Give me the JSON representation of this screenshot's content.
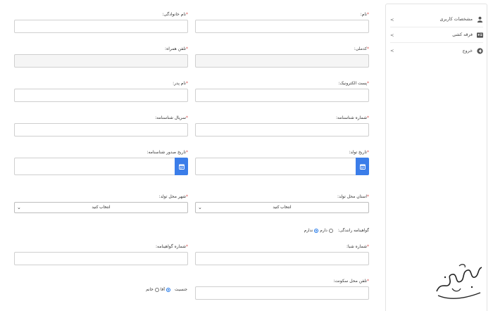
{
  "sidebar": {
    "items": [
      {
        "label": "مشخصات کاربری",
        "icon": "user-icon"
      },
      {
        "label": "فرقه کشی",
        "icon": "id-card-icon"
      },
      {
        "label": "خروج",
        "icon": "logout-icon"
      }
    ],
    "chevron": ">"
  },
  "form": {
    "required_mark": "*",
    "first_name": {
      "label": "نام:"
    },
    "last_name": {
      "label": "نام خانوادگی:"
    },
    "national_code": {
      "label": "کدملی:"
    },
    "mobile": {
      "label": "تلفن همراه:"
    },
    "email": {
      "label": "پست الکترونیک:"
    },
    "father_name": {
      "label": "نام پدر:"
    },
    "id_number": {
      "label": "شماره شناسنامه:"
    },
    "id_serial": {
      "label": "سریال شناسنامه:"
    },
    "birth_date": {
      "label": "تاریخ تولد:"
    },
    "id_issue_date": {
      "label": "تاریخ صدور شناسنامه:"
    },
    "birth_province": {
      "label": "استان محل تولد:",
      "value": "انتخاب کنید"
    },
    "birth_city": {
      "label": "شهر محل تولد:",
      "value": "انتخاب کنید"
    },
    "license": {
      "label": "گواهینامه رانندگی:",
      "option_yes": "دارم",
      "option_no": "ندارم"
    },
    "sheba": {
      "label": "شماره شبا:"
    },
    "license_number": {
      "label": "شماره گواهینامه:"
    },
    "home_phone": {
      "label": "تلفن محل سکونت:"
    },
    "gender": {
      "label": "جنسیت",
      "option_male": "آقا",
      "option_female": "خانم"
    }
  },
  "colors": {
    "accent": "#3b7de9",
    "required": "#d9534f"
  }
}
